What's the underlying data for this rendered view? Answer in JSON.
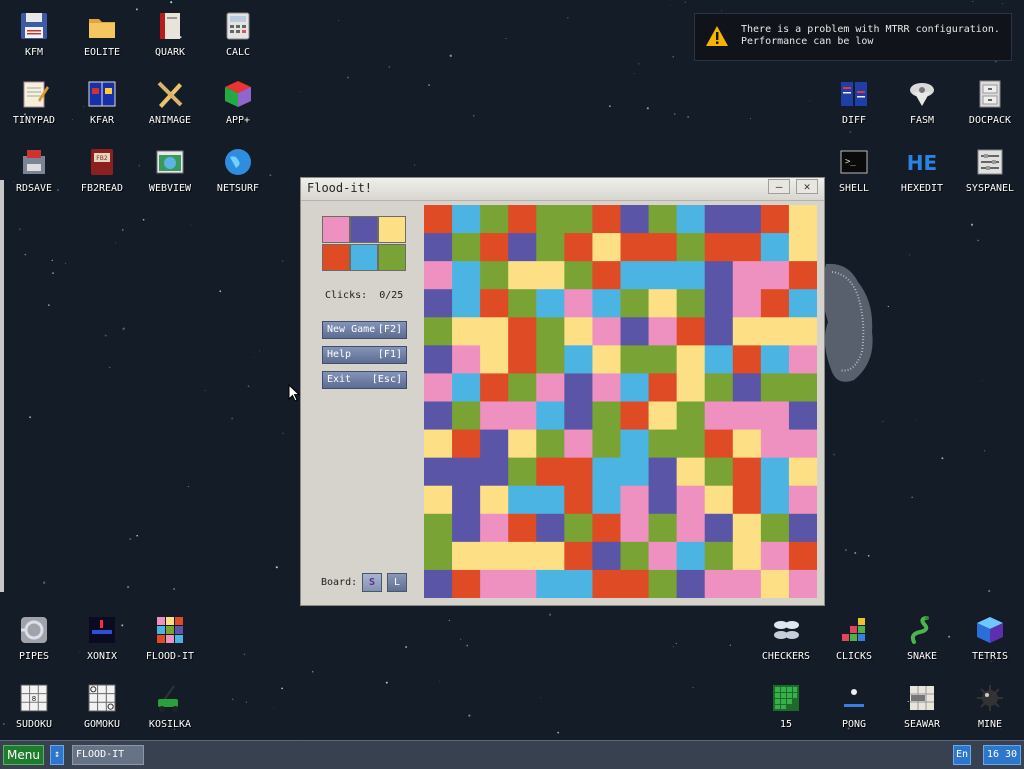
{
  "desktop": {
    "icons": [
      {
        "id": "kfm",
        "label": "KFM",
        "icon": "floppy-disk-icon"
      },
      {
        "id": "eolite",
        "label": "EOLITE",
        "icon": "folder-icon"
      },
      {
        "id": "quark",
        "label": "QUARK",
        "icon": "book-icon"
      },
      {
        "id": "calc",
        "label": "CALC",
        "icon": "calculator-icon"
      },
      {
        "id": "tinypad",
        "label": "TINYPAD",
        "icon": "notepad-icon"
      },
      {
        "id": "kfar",
        "label": "KFAR",
        "icon": "two-panel-manager-icon"
      },
      {
        "id": "animage",
        "label": "ANIMAGE",
        "icon": "pencil-ruler-icon"
      },
      {
        "id": "appplus",
        "label": "APP+",
        "icon": "rubiks-cube-icon"
      },
      {
        "id": "rdsave",
        "label": "RDSAVE",
        "icon": "disk-save-icon"
      },
      {
        "id": "fb2read",
        "label": "FB2READ",
        "icon": "ebook-icon"
      },
      {
        "id": "webview",
        "label": "WEBVIEW",
        "icon": "web-page-icon"
      },
      {
        "id": "netsurf",
        "label": "NETSURF",
        "icon": "globe-icon"
      },
      {
        "id": "diff",
        "label": "DIFF",
        "icon": "compare-icon"
      },
      {
        "id": "fasm",
        "label": "FASM",
        "icon": "assembler-icon"
      },
      {
        "id": "docpack",
        "label": "DOCPACK",
        "icon": "cabinet-icon"
      },
      {
        "id": "shell",
        "label": "SHELL",
        "icon": "terminal-icon"
      },
      {
        "id": "hexedit",
        "label": "HEXEDIT",
        "icon": "hex-editor-icon"
      },
      {
        "id": "syspanel",
        "label": "SYSPANEL",
        "icon": "sliders-icon"
      },
      {
        "id": "pipes",
        "label": "PIPES",
        "icon": "pipes-icon"
      },
      {
        "id": "xonix",
        "label": "XONIX",
        "icon": "xonix-icon"
      },
      {
        "id": "floodit",
        "label": "FLOOD-IT",
        "icon": "color-grid-icon"
      },
      {
        "id": "sudoku",
        "label": "SUDOKU",
        "icon": "sudoku-icon"
      },
      {
        "id": "gomoku",
        "label": "GOMOKU",
        "icon": "tic-tac-toe-icon"
      },
      {
        "id": "kosilka",
        "label": "KOSILKA",
        "icon": "lawn-mower-icon"
      },
      {
        "id": "checkers",
        "label": "CHECKERS",
        "icon": "checkers-icon"
      },
      {
        "id": "clicks",
        "label": "CLICKS",
        "icon": "blocks-icon"
      },
      {
        "id": "snake",
        "label": "SNAKE",
        "icon": "snake-icon"
      },
      {
        "id": "tetris",
        "label": "TETRIS",
        "icon": "tetris-cube-icon"
      },
      {
        "id": "fifteen",
        "label": "15",
        "icon": "fifteen-puzzle-icon"
      },
      {
        "id": "pong",
        "label": "PONG",
        "icon": "pong-icon"
      },
      {
        "id": "seawar",
        "label": "SEAWAR",
        "icon": "battleship-icon"
      },
      {
        "id": "mine",
        "label": "MINE",
        "icon": "mine-icon"
      }
    ]
  },
  "notification": {
    "icon": "warning-icon",
    "line1": "There is a problem with MTRR configuration.",
    "line2": "Performance can be low"
  },
  "window": {
    "title": "Flood-it!",
    "minimize": "—",
    "close": "✕",
    "clicks_label": "Clicks:",
    "clicks_value": "0/25",
    "buttons": {
      "new_game": "New Game",
      "new_game_key": "[F2]",
      "help": "Help",
      "help_key": "[F1]",
      "exit": "Exit",
      "exit_key": "[Esc]"
    },
    "board_label": "Board:",
    "board_small": "S",
    "board_large": "L"
  },
  "game": {
    "colors": {
      "P": "#ef91c0",
      "V": "#5a55a6",
      "Y": "#fde086",
      "R": "#df4b24",
      "B": "#4bb4e3",
      "G": "#79a334"
    },
    "palette": [
      "P",
      "V",
      "Y",
      "R",
      "B",
      "G"
    ],
    "rows": [
      "RBGRGGRVGBVVRY",
      "VGRVGRYRRGRRBY",
      "PBGYYGRBBBVPPR",
      "VBRGBPBGYGVPRB",
      "GYYRGYPVPRVYYY",
      "VPYRGBYGGYBRBP",
      "PBRGPVPBRYGVGG",
      "VGPPBVGRYGPPPV",
      "YRVYGPGBGGRYPP",
      "VVVGRRBBVYGRBY",
      "YVYBBRBPVPYRBP",
      "GVPRVGRPGPVYGV",
      "GYYYYRVGPBGYPR",
      "VRPPBBRRGVPPYP"
    ]
  },
  "taskbar": {
    "menu": "Menu",
    "arrow": "↕",
    "task": "FLOOD-IT",
    "lang": "En",
    "clock": "16 30"
  }
}
